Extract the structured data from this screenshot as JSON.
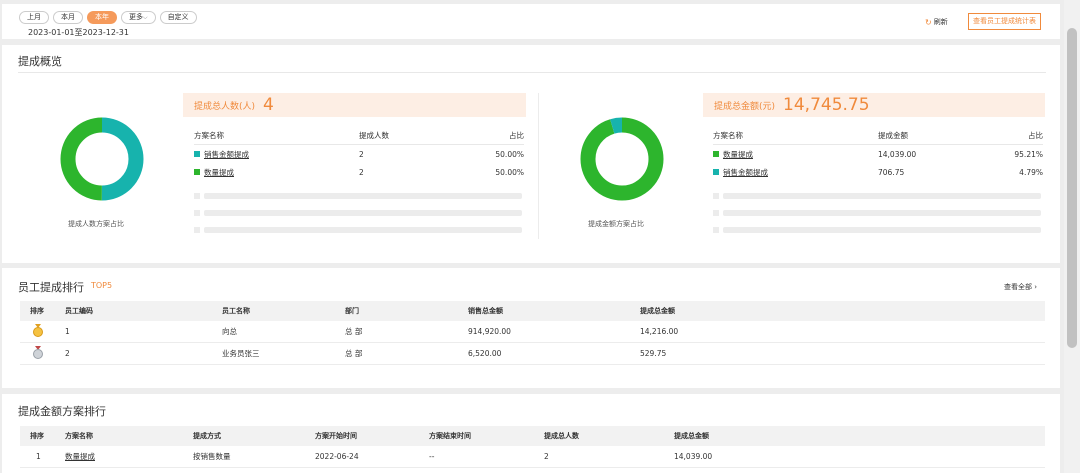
{
  "filters": {
    "buttons": [
      "上月",
      "本月",
      "本年",
      "更多",
      "自定义"
    ],
    "active": "本年",
    "more_chevron": "chevron-down-icon",
    "date_range": "2023-01-01至2023-12-31"
  },
  "toolbar": {
    "refresh_label": "刷新",
    "refresh_icon": "refresh-icon",
    "report_label": "查看员工提成统计表"
  },
  "overview": {
    "title": "提成概览",
    "people": {
      "stat_label": "提成总人数(人)",
      "stat_value": "4",
      "headers": [
        "方案名称",
        "提成人数",
        "占比"
      ],
      "rows": [
        {
          "name": "销售金额提成",
          "value": "2",
          "pct": "50.00%",
          "color": "#17b3ad",
          "fraction": 0.5
        },
        {
          "name": "数量提成",
          "value": "2",
          "pct": "50.00%",
          "color": "#2db52d",
          "fraction": 0.5
        }
      ],
      "caption": "提成人数方案占比"
    },
    "amount": {
      "stat_label": "提成总金额(元)",
      "stat_value": "14,745.75",
      "headers": [
        "方案名称",
        "提成金额",
        "占比"
      ],
      "rows": [
        {
          "name": "数量提成",
          "value": "14,039.00",
          "pct": "95.21%",
          "color": "#2db52d",
          "fraction": 0.9521
        },
        {
          "name": "销售金额提成",
          "value": "706.75",
          "pct": "4.79%",
          "color": "#17b3ad",
          "fraction": 0.0479
        }
      ],
      "caption": "提成金额方案占比"
    }
  },
  "ranking": {
    "title": "员工提成排行",
    "subtitle": "TOP5",
    "view_all": "查看全部",
    "headers": [
      "排序",
      "员工编码",
      "员工名称",
      "部门",
      "销售总金额",
      "提成总金额"
    ],
    "rows": [
      {
        "medal": "gold-medal-icon",
        "code": "1",
        "name": "向总",
        "dept": "总 部",
        "sales": "914,920.00",
        "commission": "14,216.00"
      },
      {
        "medal": "silver-medal-icon",
        "code": "2",
        "name": "业务员张三",
        "dept": "总 部",
        "sales": "6,520.00",
        "commission": "529.75"
      }
    ]
  },
  "plan_ranking": {
    "title": "提成金额方案排行",
    "headers": [
      "排序",
      "方案名称",
      "提成方式",
      "方案开始时间",
      "方案结束时间",
      "提成总人数",
      "提成总金额"
    ],
    "rows": [
      {
        "rank": "1",
        "name": "数量提成",
        "method": "按销售数量",
        "start": "2022-06-24",
        "end": "--",
        "people": "2",
        "amount": "14,039.00"
      }
    ]
  }
}
